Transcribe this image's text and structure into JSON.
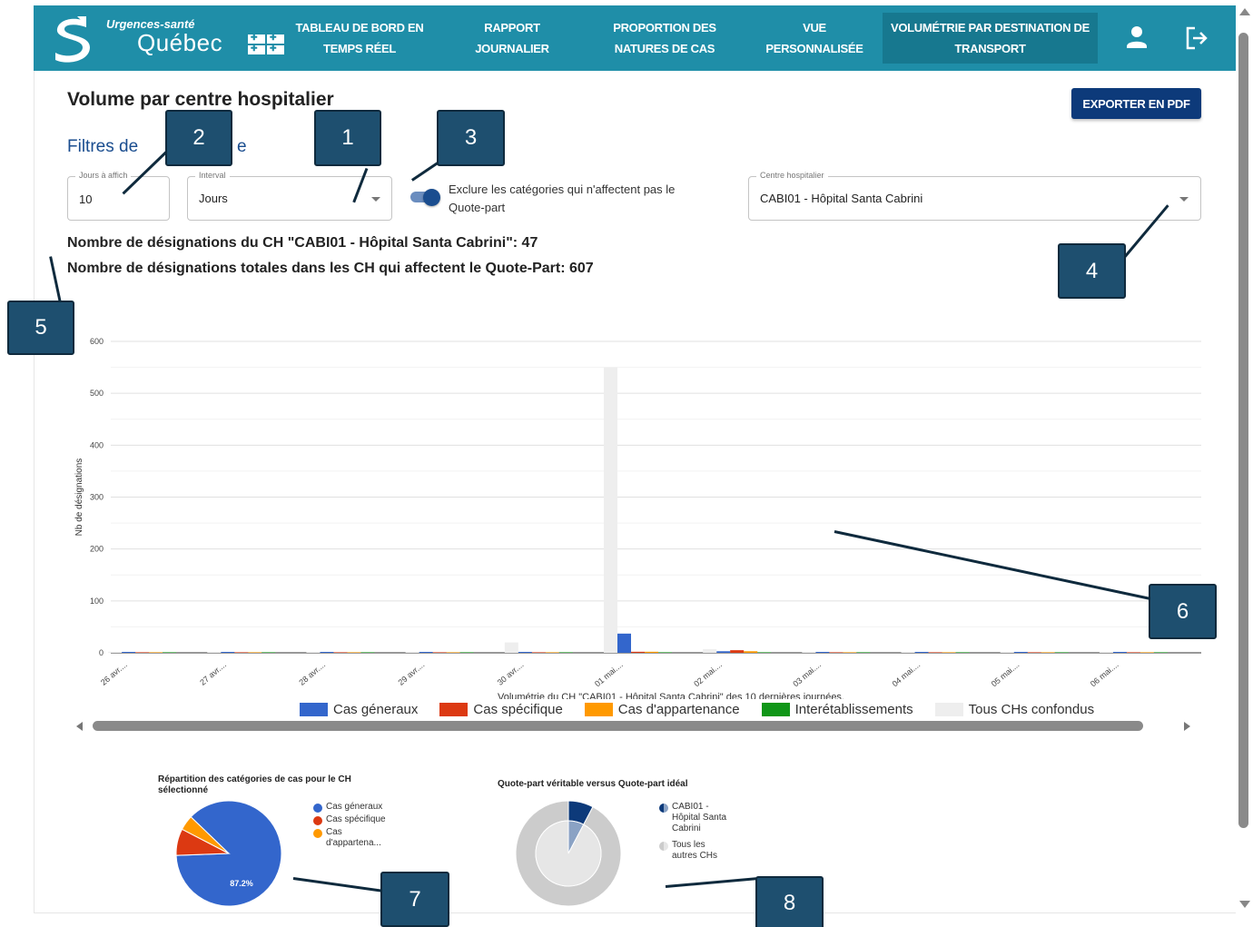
{
  "header": {
    "logo_brand": "Urgences-santé",
    "logo_city": "Québec",
    "nav": [
      {
        "line1": "TABLEAU DE BORD EN",
        "line2": "TEMPS RÉEL"
      },
      {
        "line1": "RAPPORT",
        "line2": "JOURNALIER"
      },
      {
        "line1": "PROPORTION DES",
        "line2": "NATURES DE CAS"
      },
      {
        "line1": "VUE",
        "line2": "PERSONNALISÉE"
      },
      {
        "line1": "VOLUMÉTRIE PAR DESTINATION DE",
        "line2": "TRANSPORT"
      }
    ],
    "active_index": 4,
    "icons": [
      "user-icon",
      "logout-icon"
    ]
  },
  "page": {
    "title": "Volume par centre hospitalier",
    "export_label": "EXPORTER EN PDF",
    "filters_title_visible_left": "Filtres de",
    "filters_title_visible_right": "e"
  },
  "filters": {
    "days": {
      "label": "Jours à affich",
      "value": "10"
    },
    "interval": {
      "label": "Interval",
      "value": "Jours"
    },
    "exclude_toggle": {
      "label": "Exclure les catégories qui n'affectent pas le Quote-part",
      "checked": true
    },
    "hospital": {
      "label": "Centre hospitalier",
      "value": "CABI01 - Hôpital  Santa Cabrini"
    }
  },
  "stats": {
    "line1": "Nombre de désignations du CH \"CABI01 - Hôpital Santa Cabrini\": 47",
    "line2": "Nombre de désignations totales dans les CH qui affectent le Quote-Part: 607"
  },
  "callouts": [
    "1",
    "2",
    "3",
    "4",
    "5",
    "6",
    "7",
    "8"
  ],
  "chart_data": [
    {
      "type": "bar",
      "title": "Volumétrie du CH \"CABI01 - Hôpital Santa Cabrini\" des 10 dernières journées.",
      "ylabel": "Nb de désignations",
      "xlabel": "",
      "ylim": [
        0,
        600
      ],
      "yticks": [
        0,
        100,
        200,
        300,
        400,
        500,
        600
      ],
      "categories": [
        "26 avr....",
        "27 avr....",
        "28 avr....",
        "29 avr....",
        "30 avr....",
        "01 mai....",
        "02 mai....",
        "03 mai....",
        "04 mai....",
        "05 mai....",
        "06 mai...."
      ],
      "series": [
        {
          "name": "Cas géneraux",
          "color": "#3366cc",
          "values": [
            1,
            1,
            1,
            1,
            1,
            37,
            3,
            1,
            1,
            1,
            1
          ]
        },
        {
          "name": "Cas spécifique",
          "color": "#dc3912",
          "values": [
            0,
            0,
            0,
            0,
            0,
            2,
            5,
            0,
            0,
            0,
            0
          ]
        },
        {
          "name": "Cas d'appartenance",
          "color": "#ff9900",
          "values": [
            0,
            0,
            0,
            0,
            0,
            2,
            3,
            0,
            0,
            0,
            0
          ]
        },
        {
          "name": "Interétablissements",
          "color": "#109618",
          "values": [
            0,
            0,
            0,
            0,
            0,
            0,
            0,
            0,
            0,
            0,
            0
          ]
        },
        {
          "name": "Tous CHs confondus",
          "color": "#eeeeee",
          "values": [
            2,
            2,
            2,
            2,
            20,
            550,
            7,
            2,
            2,
            2,
            2
          ]
        }
      ],
      "grid": true,
      "legend": "bottom"
    },
    {
      "type": "pie",
      "title": "Répartition des catégories de cas pour le CH sélectionné",
      "labels": [
        "Cas géneraux",
        "Cas spécifique",
        "Cas d'appartena..."
      ],
      "values": [
        87.2,
        8.2,
        4.6
      ],
      "colors": [
        "#3366cc",
        "#dc3912",
        "#ff9900"
      ],
      "slice_label": "87.2%",
      "legend": "right"
    },
    {
      "type": "pie",
      "title": "Quote-part véritable versus Quote-part idéal",
      "outer": {
        "labels": [
          "CABI01 - Hôpital Santa Cabrini",
          "Tous les autres CHs"
        ],
        "values": [
          7.7,
          92.3
        ],
        "colors": [
          "#0d3a7a",
          "#cccccc"
        ]
      },
      "inner": {
        "values": [
          7.7,
          92.3
        ],
        "colors": [
          "#8aa2c4",
          "#e6e6e6"
        ]
      },
      "legend": "right"
    }
  ]
}
